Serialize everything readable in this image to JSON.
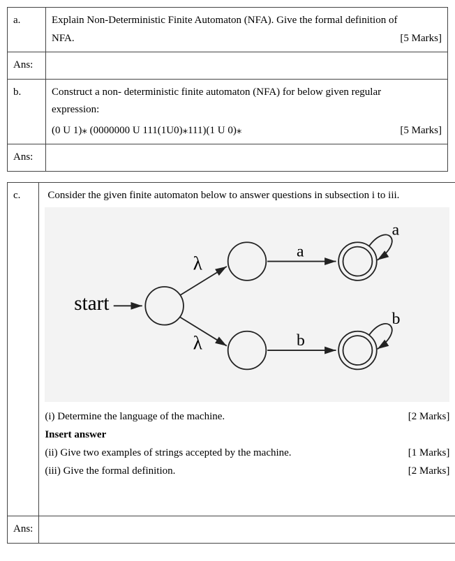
{
  "table1": {
    "rows": [
      {
        "label": "a.",
        "text_line1": "Explain Non-Deterministic Finite Automaton (NFA). Give the formal definition of",
        "text_line2": "NFA.",
        "marks": "[5 Marks]"
      },
      {
        "label": "Ans:",
        "text": ""
      },
      {
        "label": "b.",
        "text_line1": " Construct a non- deterministic finite automaton (NFA) for below given regular",
        "text_line2": "expression:",
        "text_line3": "(0 U 1)⁎ (0000000 U 111(1U0)⁎111)(1 U 0)⁎",
        "marks": "[5 Marks]"
      },
      {
        "label": "Ans:",
        "text": ""
      }
    ]
  },
  "table2": {
    "rowC": {
      "label": "c.",
      "intro": "Consider the given finite automaton below to answer questions in subsection i to iii.",
      "diagram": {
        "start_label": "start",
        "lambda1": "λ",
        "lambda2": "λ",
        "a_label": "a",
        "a_loop": "a",
        "b_label": "b",
        "b_loop": "b"
      },
      "sub_i_text": "(i)  Determine the language of the machine.",
      "sub_i_marks": "[2 Marks]",
      "insert_answer": "Insert answer",
      "sub_ii_text": "(ii) Give two examples of strings accepted by the machine.",
      "sub_ii_marks": "[1 Marks]",
      "sub_iii_text": "(iii) Give the formal definition.",
      "sub_iii_marks": "[2 Marks]"
    },
    "ans_label": "Ans:"
  }
}
